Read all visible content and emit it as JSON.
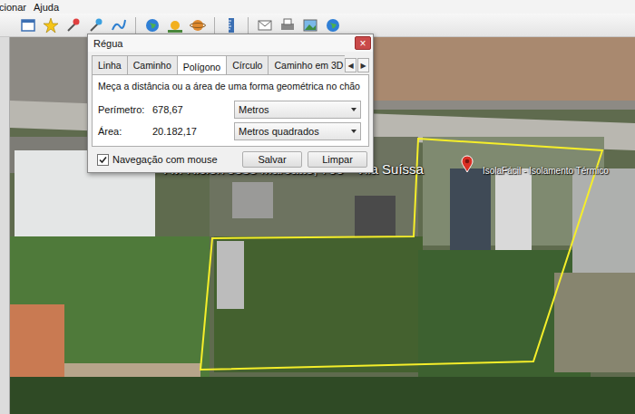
{
  "menu": [
    "cionar",
    "Ajuda"
  ],
  "dialog": {
    "title": "Régua",
    "close": "×",
    "tabs": [
      {
        "label": "Linha",
        "selected": false
      },
      {
        "label": "Caminho",
        "selected": false
      },
      {
        "label": "Polígono",
        "selected": true
      },
      {
        "label": "Círculo",
        "selected": false
      },
      {
        "label": "Caminho em 3D",
        "selected": false
      }
    ],
    "tab_scroll": [
      "◀",
      "▶"
    ],
    "description": "Meça a distância ou a área de uma forma geométrica no chão",
    "fields": [
      {
        "label": "Perímetro:",
        "value": "678,67",
        "unit": "Metros"
      },
      {
        "label": "Área:",
        "value": "20.182,17",
        "unit": "Metros quadrados"
      }
    ],
    "checkbox": {
      "label": "Navegação com mouse",
      "checked": true
    },
    "buttons": [
      "Salvar",
      "Limpar"
    ]
  },
  "map": {
    "labels": [
      {
        "text": "Av. Ricieri José Marcatto, 700 - Vila Suíssa",
        "kind": "address"
      },
      {
        "text": "IsolaFácil - Isolamento Térmico",
        "kind": "place"
      }
    ]
  }
}
